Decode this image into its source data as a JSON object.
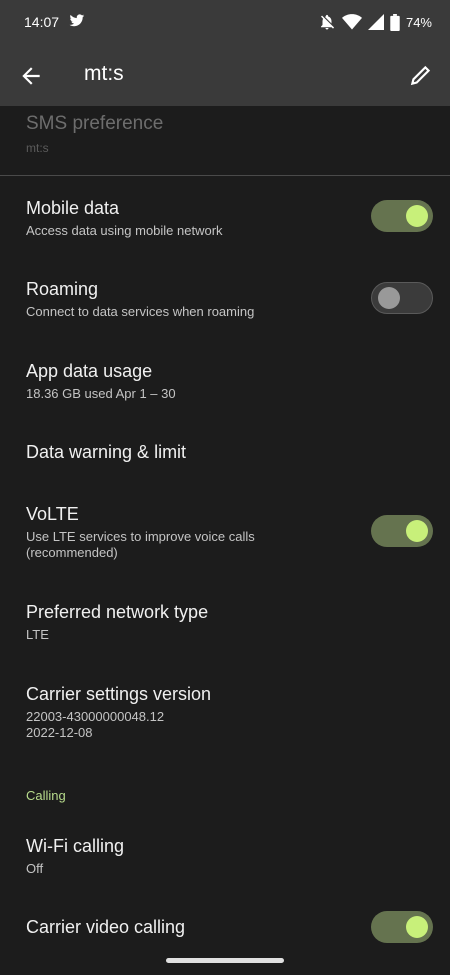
{
  "status_bar": {
    "time": "14:07",
    "battery": "74%"
  },
  "app_bar": {
    "title": "mt:s"
  },
  "sms_preference": {
    "title": "SMS preference",
    "subtitle": "mt:s"
  },
  "settings": {
    "mobile_data": {
      "title": "Mobile data",
      "subtitle": "Access data using mobile network",
      "enabled": true
    },
    "roaming": {
      "title": "Roaming",
      "subtitle": "Connect to data services when roaming",
      "enabled": false
    },
    "app_data_usage": {
      "title": "App data usage",
      "subtitle": "18.36 GB used Apr 1 – 30"
    },
    "data_warning": {
      "title": "Data warning & limit"
    },
    "volte": {
      "title": "VoLTE",
      "subtitle": "Use LTE services to improve voice calls (recommended)",
      "enabled": true
    },
    "preferred_network": {
      "title": "Preferred network type",
      "subtitle": "LTE"
    },
    "carrier_settings": {
      "title": "Carrier settings version",
      "subtitle_line1": "22003-43000000048.12",
      "subtitle_line2": "2022-12-08"
    }
  },
  "calling_section": {
    "header": "Calling",
    "wifi_calling": {
      "title": "Wi-Fi calling",
      "subtitle": "Off"
    },
    "carrier_video": {
      "title": "Carrier video calling",
      "enabled": true
    }
  },
  "colors": {
    "background": "#1c1c1c",
    "app_bar": "#3a3a3a",
    "accent": "#b7db8c",
    "toggle_on_track": "#65734f",
    "toggle_on_knob": "#c8f07a"
  }
}
